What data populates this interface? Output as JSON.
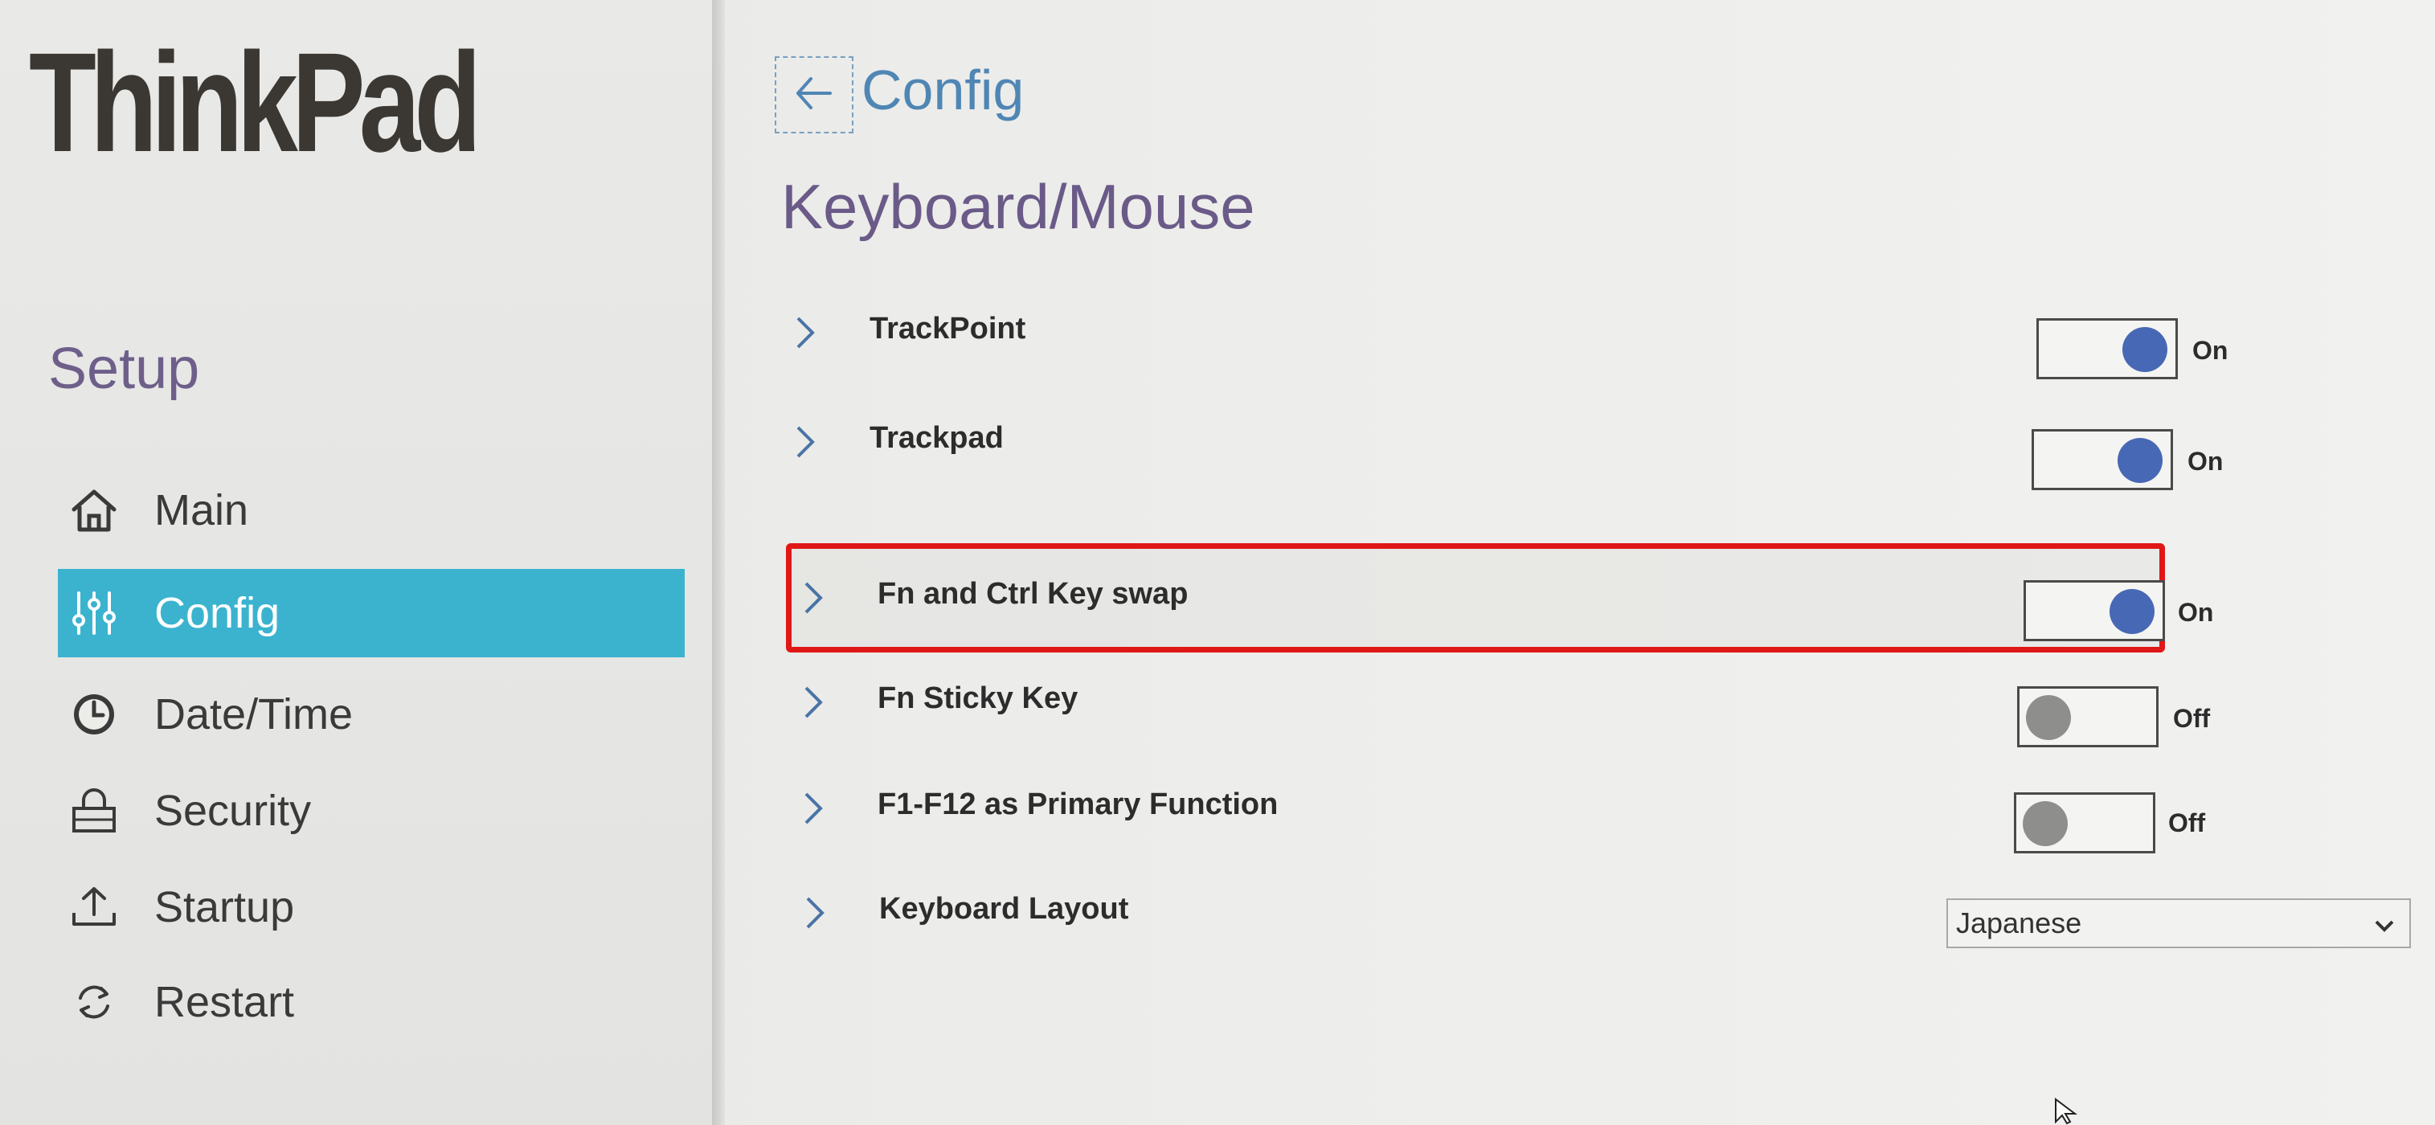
{
  "brand": {
    "logo_text": "ThinkPad",
    "colors": {
      "logo": "#3b3834",
      "logo_dot": "#d8352a"
    }
  },
  "sidebar": {
    "title": "Setup",
    "items": [
      {
        "label": "Main",
        "icon": "home-icon",
        "active": false
      },
      {
        "label": "Config",
        "icon": "sliders-icon",
        "active": true
      },
      {
        "label": "Date/Time",
        "icon": "clock-icon",
        "active": false
      },
      {
        "label": "Security",
        "icon": "lock-icon",
        "active": false
      },
      {
        "label": "Startup",
        "icon": "upload-icon",
        "active": false
      },
      {
        "label": "Restart",
        "icon": "refresh-icon",
        "active": false
      }
    ],
    "colors": {
      "active_bg": "#3bb3cf",
      "title": "#6e5f8a"
    }
  },
  "header": {
    "back_icon": "arrow-left-icon",
    "breadcrumb": "Config",
    "page_title": "Keyboard/Mouse"
  },
  "settings": [
    {
      "label": "TrackPoint",
      "type": "toggle",
      "on": true,
      "state_label": "On"
    },
    {
      "label": "Trackpad",
      "type": "toggle",
      "on": true,
      "state_label": "On"
    },
    {
      "label": "Fn and Ctrl Key swap",
      "type": "toggle",
      "on": true,
      "state_label": "On",
      "highlighted": true
    },
    {
      "label": "Fn Sticky Key",
      "type": "toggle",
      "on": false,
      "state_label": "Off"
    },
    {
      "label": "F1-F12 as Primary Function",
      "type": "toggle",
      "on": false,
      "state_label": "Off"
    },
    {
      "label": "Keyboard Layout",
      "type": "select",
      "value": "Japanese"
    }
  ],
  "colors": {
    "toggle_on_knob": "#4768b4",
    "toggle_off_knob": "#8e8e8c",
    "highlight": "#e01717",
    "accent": "#4f86b4"
  }
}
